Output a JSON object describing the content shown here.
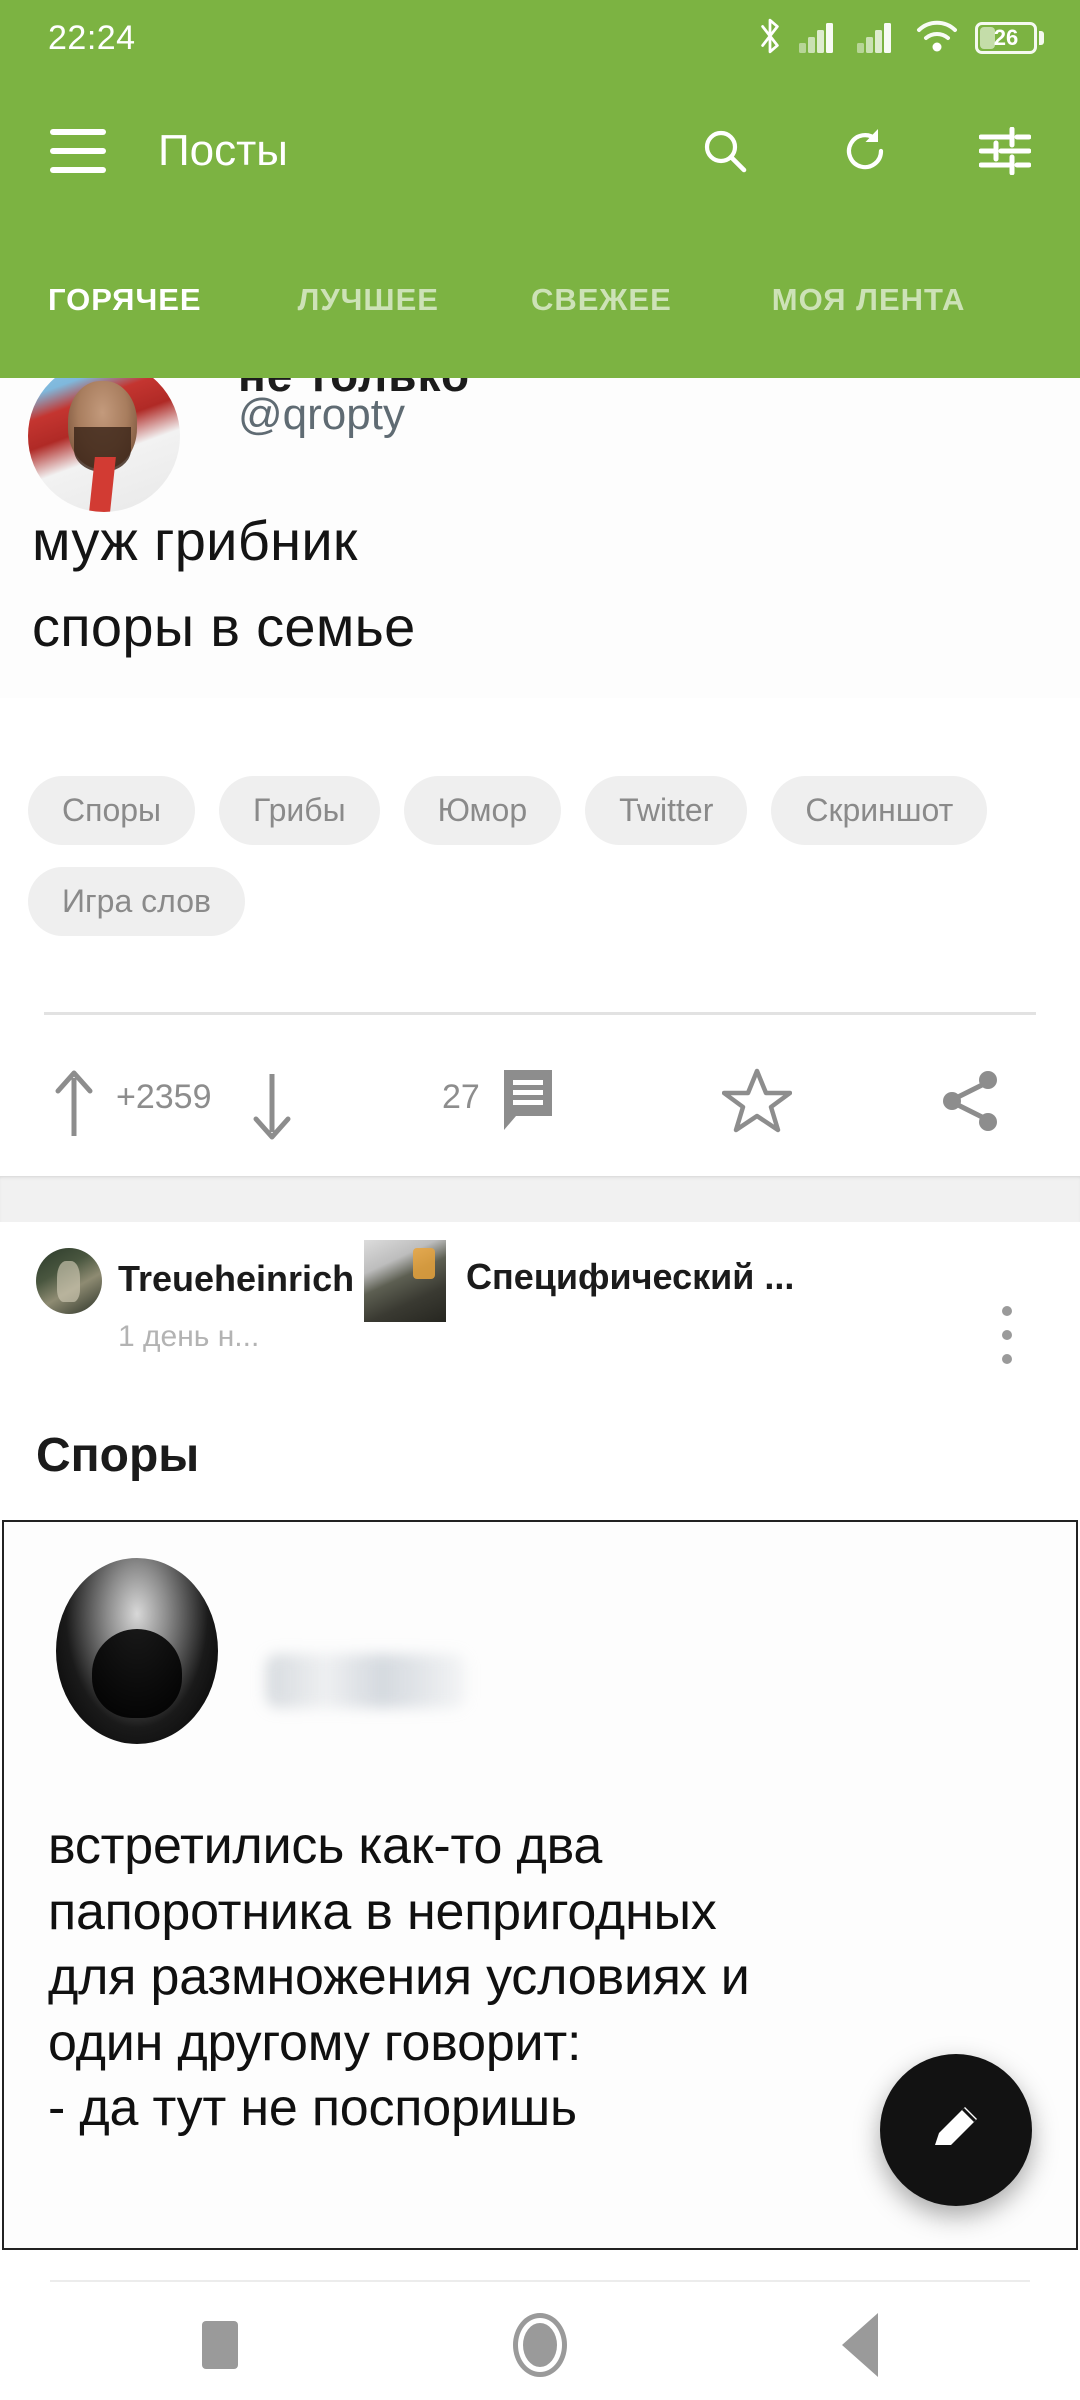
{
  "status_bar": {
    "time": "22:24",
    "battery_percent": "26",
    "icons": [
      "bluetooth-icon",
      "signal-1-icon",
      "signal-2-icon",
      "wifi-icon",
      "battery-icon"
    ]
  },
  "toolbar": {
    "menu_icon": "hamburger-menu-icon",
    "title": "Посты",
    "actions": [
      {
        "name": "search-icon",
        "label": "Поиск"
      },
      {
        "name": "refresh-icon",
        "label": "Обновить"
      },
      {
        "name": "filter-icon",
        "label": "Фильтры"
      }
    ]
  },
  "tabs": [
    {
      "label": "ГОРЯЧЕЕ",
      "active": true
    },
    {
      "label": "ЛУЧШЕЕ",
      "active": false
    },
    {
      "label": "СВЕЖЕЕ",
      "active": false
    },
    {
      "label": "МОЯ ЛЕНТА",
      "active": false
    }
  ],
  "posts": [
    {
      "media": {
        "clipped_name": "не только",
        "handle": "@qropty",
        "line1": "муж грибник",
        "line2": "споры в семье"
      },
      "tags": [
        "Споры",
        "Грибы",
        "Юмор",
        "Twitter",
        "Скриншот",
        "Игра слов"
      ],
      "actions": {
        "score": "+2359",
        "comments": "27",
        "upvote_icon": "arrow-up-icon",
        "downvote_icon": "arrow-down-icon",
        "comment_icon": "comment-icon",
        "favorite_icon": "star-icon",
        "share_icon": "share-icon"
      }
    },
    {
      "author": "Treueheinrich",
      "community": "Специфический ...",
      "time": "1 день н...",
      "menu_icon": "kebab-menu-icon",
      "title": "Споры",
      "media": {
        "username_blurred": true,
        "lines": [
          "встретились как-то два",
          "папоротника в непригодных",
          "для размножения условиях и",
          "один другому говорит:",
          "- да тут не поспоришь"
        ]
      }
    }
  ],
  "fab": {
    "icon": "pencil-edit-icon",
    "label": "Создать пост"
  },
  "nav_bar": {
    "recents": "recents-square-icon",
    "home": "home-circle-icon",
    "back": "back-triangle-icon"
  },
  "colors": {
    "accent_green": "#7CB342",
    "tag_bg": "#EFEFEF",
    "muted_text": "#8D8D8D",
    "fab_bg": "#121212"
  }
}
